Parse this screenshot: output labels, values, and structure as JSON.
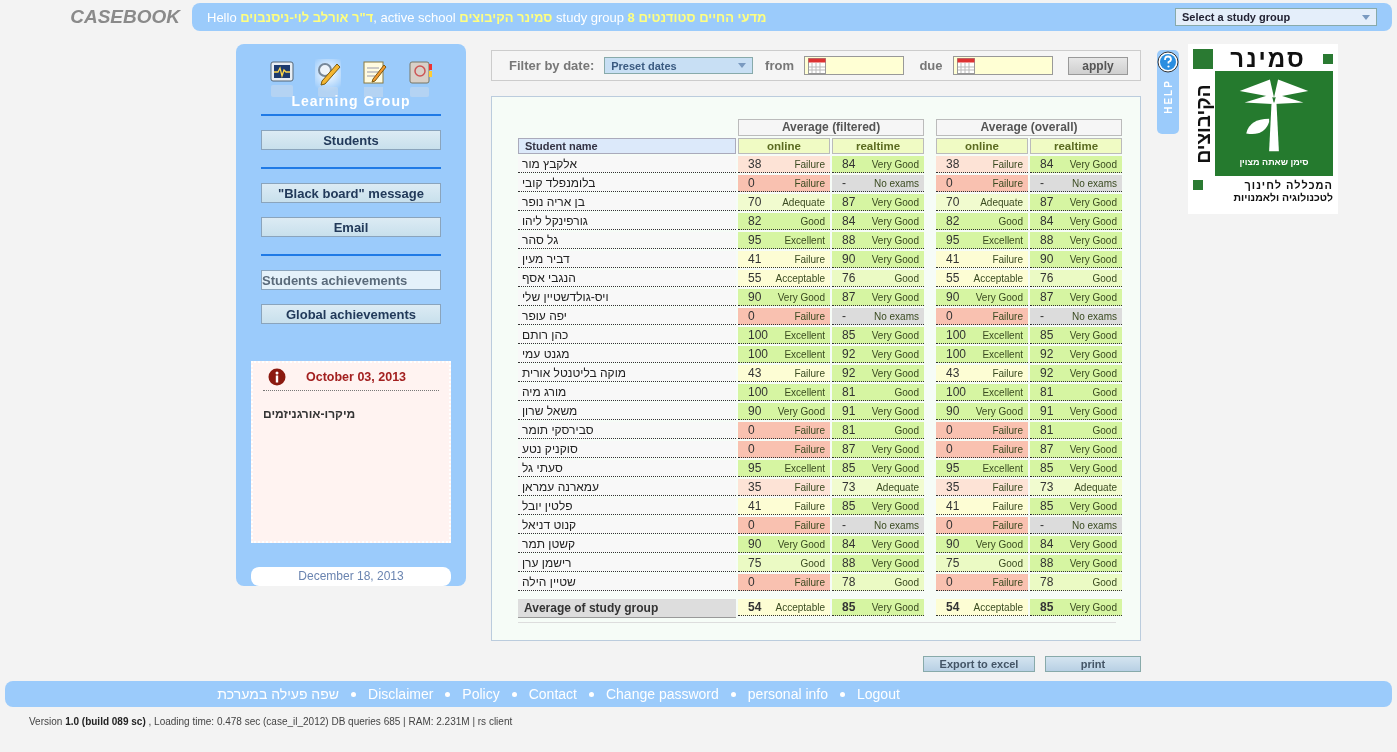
{
  "header": {
    "brand": "CASEBOOK",
    "greeting": "Hello **ד\"ר אורלב לוי-ניסנבוים**, active school **סמינר הקיבוצים** study group **8 מדעי החיים סטודנטים**",
    "study_group_select": "Select a study group"
  },
  "sidebar": {
    "icons": [
      {
        "kind": "monitor",
        "selected": false
      },
      {
        "kind": "magnifier-pencil",
        "selected": true
      },
      {
        "kind": "notepad",
        "selected": false
      },
      {
        "kind": "address-book",
        "selected": false
      }
    ],
    "title": "Learning Group",
    "button_groups": [
      [
        {
          "label": "Students",
          "selected": false
        }
      ],
      [
        {
          "label": "\"Black board\" message",
          "selected": false
        },
        {
          "label": "Email",
          "selected": false
        }
      ],
      [
        {
          "label": "Students achievements",
          "selected": true
        },
        {
          "label": "Global achievements",
          "selected": false
        }
      ]
    ],
    "note": {
      "date": "October 03, 2013",
      "text": "מיקרו-אורגניזמים"
    },
    "today": "December 18, 2013"
  },
  "filter": {
    "label": "Filter by date:",
    "preset": "Preset dates",
    "from_label": "from",
    "due_label": "due",
    "apply": "apply"
  },
  "table": {
    "name_header": "Student name",
    "groups": [
      "Average (filtered)",
      "Average (overall)"
    ],
    "subheaders": [
      "online",
      "realtime",
      "online",
      "realtime"
    ],
    "rows": [
      {
        "name": "אלקבץ מור",
        "cells": [
          {
            "score": "38",
            "grade": "Failure",
            "color": "#fde3d6"
          },
          {
            "score": "84",
            "grade": "Very Good",
            "color": "#d6f5a2"
          },
          {
            "score": "38",
            "grade": "Failure",
            "color": "#fde3d6"
          },
          {
            "score": "84",
            "grade": "Very Good",
            "color": "#d6f5a2"
          }
        ]
      },
      {
        "name": "בלומנפלד קובי",
        "cells": [
          {
            "score": "0",
            "grade": "Failure",
            "color": "#f9c1b0"
          },
          {
            "score": "-",
            "grade": "No exams",
            "color": "#dcdcdc"
          },
          {
            "score": "0",
            "grade": "Failure",
            "color": "#f9c1b0"
          },
          {
            "score": "-",
            "grade": "No exams",
            "color": "#dcdcdc"
          }
        ]
      },
      {
        "name": "בן אריה נופר",
        "cells": [
          {
            "score": "70",
            "grade": "Adequate",
            "color": "#f1fbcf"
          },
          {
            "score": "87",
            "grade": "Very Good",
            "color": "#d6f5a2"
          },
          {
            "score": "70",
            "grade": "Adequate",
            "color": "#f1fbcf"
          },
          {
            "score": "87",
            "grade": "Very Good",
            "color": "#d6f5a2"
          }
        ]
      },
      {
        "name": "גורפינקל ליהו",
        "cells": [
          {
            "score": "82",
            "grade": "Good",
            "color": "#d6f5a2"
          },
          {
            "score": "84",
            "grade": "Very Good",
            "color": "#d6f5a2"
          },
          {
            "score": "82",
            "grade": "Good",
            "color": "#d6f5a2"
          },
          {
            "score": "84",
            "grade": "Very Good",
            "color": "#d6f5a2"
          }
        ]
      },
      {
        "name": "גל סהר",
        "cells": [
          {
            "score": "95",
            "grade": "Excellent",
            "color": "#d6f5a2"
          },
          {
            "score": "88",
            "grade": "Very Good",
            "color": "#d6f5a2"
          },
          {
            "score": "95",
            "grade": "Excellent",
            "color": "#d6f5a2"
          },
          {
            "score": "88",
            "grade": "Very Good",
            "color": "#d6f5a2"
          }
        ]
      },
      {
        "name": "דביר מעין",
        "cells": [
          {
            "score": "41",
            "grade": "Failure",
            "color": "#fdfdd4"
          },
          {
            "score": "90",
            "grade": "Very Good",
            "color": "#d6f5a2"
          },
          {
            "score": "41",
            "grade": "Failure",
            "color": "#fdfdd4"
          },
          {
            "score": "90",
            "grade": "Very Good",
            "color": "#d6f5a2"
          }
        ]
      },
      {
        "name": "הנגבי אסף",
        "cells": [
          {
            "score": "55",
            "grade": "Acceptable",
            "color": "#fdfdd4"
          },
          {
            "score": "76",
            "grade": "Good",
            "color": "#ebfac4"
          },
          {
            "score": "55",
            "grade": "Acceptable",
            "color": "#fdfdd4"
          },
          {
            "score": "76",
            "grade": "Good",
            "color": "#ebfac4"
          }
        ]
      },
      {
        "name": "ויס-גולדשטיין שלי",
        "cells": [
          {
            "score": "90",
            "grade": "Very Good",
            "color": "#d6f5a2"
          },
          {
            "score": "87",
            "grade": "Very Good",
            "color": "#d6f5a2"
          },
          {
            "score": "90",
            "grade": "Very Good",
            "color": "#d6f5a2"
          },
          {
            "score": "87",
            "grade": "Very Good",
            "color": "#d6f5a2"
          }
        ]
      },
      {
        "name": "יפה עופר",
        "cells": [
          {
            "score": "0",
            "grade": "Failure",
            "color": "#f9c1b0"
          },
          {
            "score": "-",
            "grade": "No exams",
            "color": "#dcdcdc"
          },
          {
            "score": "0",
            "grade": "Failure",
            "color": "#f9c1b0"
          },
          {
            "score": "-",
            "grade": "No exams",
            "color": "#dcdcdc"
          }
        ]
      },
      {
        "name": "כהן רותם",
        "cells": [
          {
            "score": "100",
            "grade": "Excellent",
            "color": "#d6f5a2"
          },
          {
            "score": "85",
            "grade": "Very Good",
            "color": "#d6f5a2"
          },
          {
            "score": "100",
            "grade": "Excellent",
            "color": "#d6f5a2"
          },
          {
            "score": "85",
            "grade": "Very Good",
            "color": "#d6f5a2"
          }
        ]
      },
      {
        "name": "מגנט עמי",
        "cells": [
          {
            "score": "100",
            "grade": "Excellent",
            "color": "#d6f5a2"
          },
          {
            "score": "92",
            "grade": "Very Good",
            "color": "#d6f5a2"
          },
          {
            "score": "100",
            "grade": "Excellent",
            "color": "#d6f5a2"
          },
          {
            "score": "92",
            "grade": "Very Good",
            "color": "#d6f5a2"
          }
        ]
      },
      {
        "name": "מוקה בליטנטל אורית",
        "cells": [
          {
            "score": "43",
            "grade": "Failure",
            "color": "#fdfdd4"
          },
          {
            "score": "92",
            "grade": "Very Good",
            "color": "#d6f5a2"
          },
          {
            "score": "43",
            "grade": "Failure",
            "color": "#fdfdd4"
          },
          {
            "score": "92",
            "grade": "Very Good",
            "color": "#d6f5a2"
          }
        ]
      },
      {
        "name": "מורג מיה",
        "cells": [
          {
            "score": "100",
            "grade": "Excellent",
            "color": "#d6f5a2"
          },
          {
            "score": "81",
            "grade": "Good",
            "color": "#d6f5a2"
          },
          {
            "score": "100",
            "grade": "Excellent",
            "color": "#d6f5a2"
          },
          {
            "score": "81",
            "grade": "Good",
            "color": "#d6f5a2"
          }
        ]
      },
      {
        "name": "משאל שרון",
        "cells": [
          {
            "score": "90",
            "grade": "Very Good",
            "color": "#d6f5a2"
          },
          {
            "score": "91",
            "grade": "Very Good",
            "color": "#d6f5a2"
          },
          {
            "score": "90",
            "grade": "Very Good",
            "color": "#d6f5a2"
          },
          {
            "score": "91",
            "grade": "Very Good",
            "color": "#d6f5a2"
          }
        ]
      },
      {
        "name": "סבירסקי תומר",
        "cells": [
          {
            "score": "0",
            "grade": "Failure",
            "color": "#f9c1b0"
          },
          {
            "score": "81",
            "grade": "Good",
            "color": "#d6f5a2"
          },
          {
            "score": "0",
            "grade": "Failure",
            "color": "#f9c1b0"
          },
          {
            "score": "81",
            "grade": "Good",
            "color": "#d6f5a2"
          }
        ]
      },
      {
        "name": "סוקניק נטע",
        "cells": [
          {
            "score": "0",
            "grade": "Failure",
            "color": "#f9c1b0"
          },
          {
            "score": "87",
            "grade": "Very Good",
            "color": "#d6f5a2"
          },
          {
            "score": "0",
            "grade": "Failure",
            "color": "#f9c1b0"
          },
          {
            "score": "87",
            "grade": "Very Good",
            "color": "#d6f5a2"
          }
        ]
      },
      {
        "name": "סעתי גל",
        "cells": [
          {
            "score": "95",
            "grade": "Excellent",
            "color": "#d6f5a2"
          },
          {
            "score": "85",
            "grade": "Very Good",
            "color": "#d6f5a2"
          },
          {
            "score": "95",
            "grade": "Excellent",
            "color": "#d6f5a2"
          },
          {
            "score": "85",
            "grade": "Very Good",
            "color": "#d6f5a2"
          }
        ]
      },
      {
        "name": "עמארנה עמראן",
        "cells": [
          {
            "score": "35",
            "grade": "Failure",
            "color": "#fde3d6"
          },
          {
            "score": "73",
            "grade": "Adequate",
            "color": "#f1fbcf"
          },
          {
            "score": "35",
            "grade": "Failure",
            "color": "#fde3d6"
          },
          {
            "score": "73",
            "grade": "Adequate",
            "color": "#f1fbcf"
          }
        ]
      },
      {
        "name": "פלטין יובל",
        "cells": [
          {
            "score": "41",
            "grade": "Failure",
            "color": "#fdfdd4"
          },
          {
            "score": "85",
            "grade": "Very Good",
            "color": "#d6f5a2"
          },
          {
            "score": "41",
            "grade": "Failure",
            "color": "#fdfdd4"
          },
          {
            "score": "85",
            "grade": "Very Good",
            "color": "#d6f5a2"
          }
        ]
      },
      {
        "name": "קנוט דניאל",
        "cells": [
          {
            "score": "0",
            "grade": "Failure",
            "color": "#f9c1b0"
          },
          {
            "score": "-",
            "grade": "No exams",
            "color": "#dcdcdc"
          },
          {
            "score": "0",
            "grade": "Failure",
            "color": "#f9c1b0"
          },
          {
            "score": "-",
            "grade": "No exams",
            "color": "#dcdcdc"
          }
        ]
      },
      {
        "name": "קשטן תמר",
        "cells": [
          {
            "score": "90",
            "grade": "Very Good",
            "color": "#d6f5a2"
          },
          {
            "score": "84",
            "grade": "Very Good",
            "color": "#d6f5a2"
          },
          {
            "score": "90",
            "grade": "Very Good",
            "color": "#d6f5a2"
          },
          {
            "score": "84",
            "grade": "Very Good",
            "color": "#d6f5a2"
          }
        ]
      },
      {
        "name": "רישמן ערן",
        "cells": [
          {
            "score": "75",
            "grade": "Good",
            "color": "#ebfac4"
          },
          {
            "score": "88",
            "grade": "Very Good",
            "color": "#d6f5a2"
          },
          {
            "score": "75",
            "grade": "Good",
            "color": "#ebfac4"
          },
          {
            "score": "88",
            "grade": "Very Good",
            "color": "#d6f5a2"
          }
        ]
      },
      {
        "name": "שטיין הילה",
        "cells": [
          {
            "score": "0",
            "grade": "Failure",
            "color": "#f9c1b0"
          },
          {
            "score": "78",
            "grade": "Good",
            "color": "#ebfac4"
          },
          {
            "score": "0",
            "grade": "Failure",
            "color": "#f9c1b0"
          },
          {
            "score": "78",
            "grade": "Good",
            "color": "#ebfac4"
          }
        ]
      }
    ],
    "average": {
      "label": "Average of study group",
      "cells": [
        {
          "score": "54",
          "grade": "Acceptable",
          "color": "#fdfdd4"
        },
        {
          "score": "85",
          "grade": "Very Good",
          "color": "#d6f5a2"
        },
        {
          "score": "54",
          "grade": "Acceptable",
          "color": "#fdfdd4"
        },
        {
          "score": "85",
          "grade": "Very Good",
          "color": "#d6f5a2"
        }
      ]
    }
  },
  "actions": [
    "Export to excel",
    "print"
  ],
  "help": "HELP",
  "logo": {
    "top": "סמינר",
    "side": "הקיבוצים",
    "motto": "סימן שאתה מצוין",
    "line1": "המכללה לחינוך",
    "line2": "לטכנולוגיה ולאמנויות"
  },
  "footer": {
    "links": [
      "שפה פעילה במערכת",
      "Disclaimer",
      "Policy",
      "Contact",
      "Change password",
      "personal info",
      "Logout"
    ],
    "version": "Version **1.0 (build 089 sc)** , Loading time: 0.478 sec  (case_il_2012) DB queries 685 | RAM: 2.231M | rs client"
  }
}
